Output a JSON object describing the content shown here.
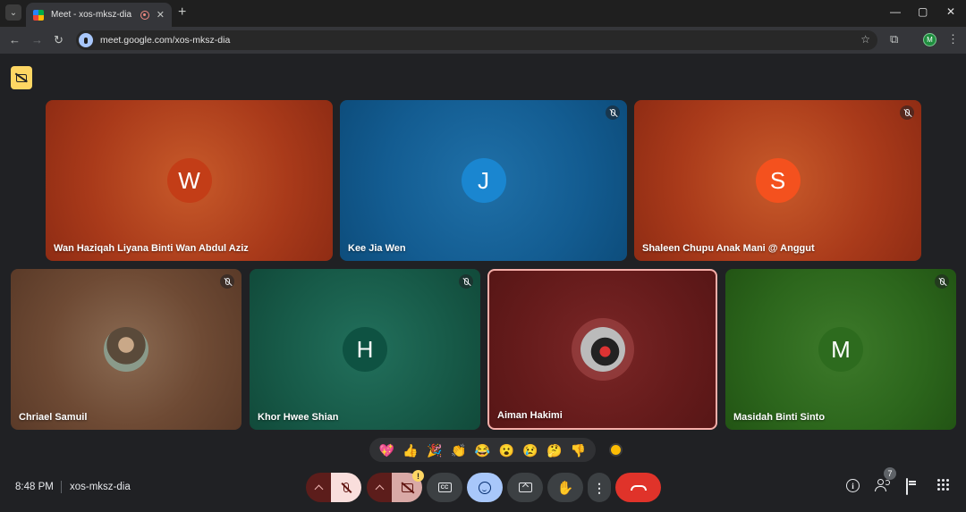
{
  "browser": {
    "tab_title": "Meet - xos-mksz-dia",
    "tab_close": "✕",
    "new_tab": "+",
    "url": "meet.google.com/xos-mksz-dia",
    "profile_initial": "M",
    "window_controls": {
      "minimize": "—",
      "maximize": "▢",
      "close": "✕"
    }
  },
  "tiles": [
    {
      "name": "Wan Haziqah Liyana Binti Wan Abdul Aziz",
      "initial": "W",
      "muted": false
    },
    {
      "name": "Kee Jia Wen",
      "initial": "J",
      "muted": true
    },
    {
      "name": "Shaleen Chupu Anak Mani @ Anggut",
      "initial": "S",
      "muted": true
    },
    {
      "name": "Chriael Samuil",
      "initial": "",
      "muted": true,
      "avatar": "photo"
    },
    {
      "name": "Khor Hwee Shian",
      "initial": "H",
      "muted": true
    },
    {
      "name": "Aiman Hakimi",
      "initial": "",
      "muted": false,
      "avatar": "photo",
      "speaking": true
    },
    {
      "name": "Masidah Binti Sinto",
      "initial": "M",
      "muted": true
    }
  ],
  "reactions": [
    "💖",
    "👍",
    "🎉",
    "👏",
    "😂",
    "😮",
    "😢",
    "🤔",
    "👎"
  ],
  "meeting": {
    "time": "8:48 PM",
    "code": "xos-mksz-dia",
    "participant_count": "7",
    "camera_warning": "!"
  },
  "colors": {
    "accent_blue": "#a8c7fa",
    "hangup_red": "#e0332a",
    "speaking_border": "#f6aea9",
    "caption_badge": "#fdd663"
  }
}
